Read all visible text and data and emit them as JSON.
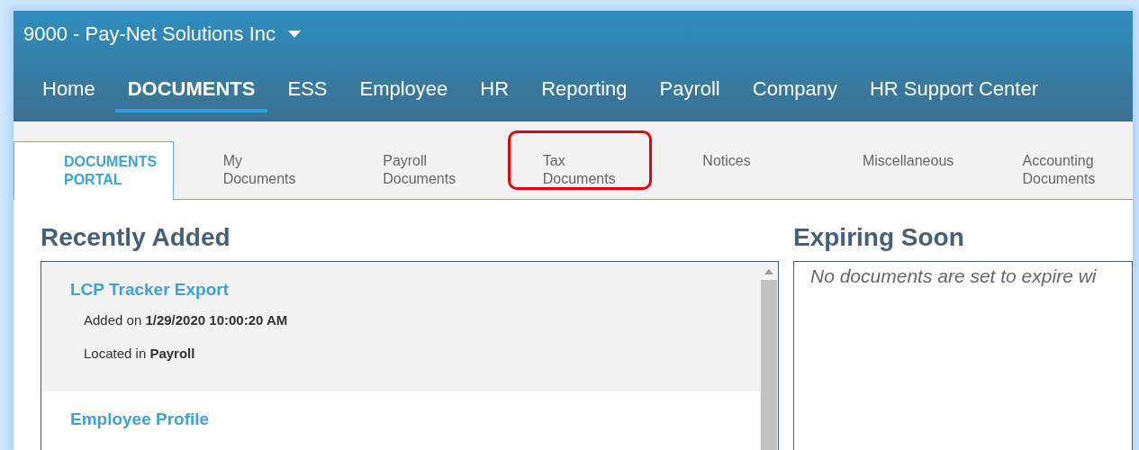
{
  "company_selector": {
    "label": "9000 - Pay-Net Solutions Inc"
  },
  "nav": [
    {
      "label": "Home",
      "selected": false
    },
    {
      "label": "DOCUMENTS",
      "selected": true
    },
    {
      "label": "ESS",
      "selected": false
    },
    {
      "label": "Employee",
      "selected": false
    },
    {
      "label": "HR",
      "selected": false
    },
    {
      "label": "Reporting",
      "selected": false
    },
    {
      "label": "Payroll",
      "selected": false
    },
    {
      "label": "Company",
      "selected": false
    },
    {
      "label": "HR Support Center",
      "selected": false
    }
  ],
  "tabs": [
    {
      "label": "DOCUMENTS PORTAL",
      "selected": true,
      "highlighted": false
    },
    {
      "label": "My Documents",
      "selected": false,
      "highlighted": false
    },
    {
      "label": "Payroll Documents",
      "selected": false,
      "highlighted": false
    },
    {
      "label": "Tax Documents",
      "selected": false,
      "highlighted": true
    },
    {
      "label": "Notices",
      "selected": false,
      "highlighted": false
    },
    {
      "label": "Miscellaneous",
      "selected": false,
      "highlighted": false
    },
    {
      "label": "Accounting Documents",
      "selected": false,
      "highlighted": false
    }
  ],
  "recently_added": {
    "title": "Recently Added",
    "items": [
      {
        "title": "LCP Tracker Export",
        "added": "Added on **1/29/2020 10:00:20 AM**",
        "location": "Located in **Payroll**"
      },
      {
        "title": "Employee Profile"
      }
    ]
  },
  "expiring_soon": {
    "title": "Expiring Soon",
    "message": "No documents are set to expire wi"
  }
}
